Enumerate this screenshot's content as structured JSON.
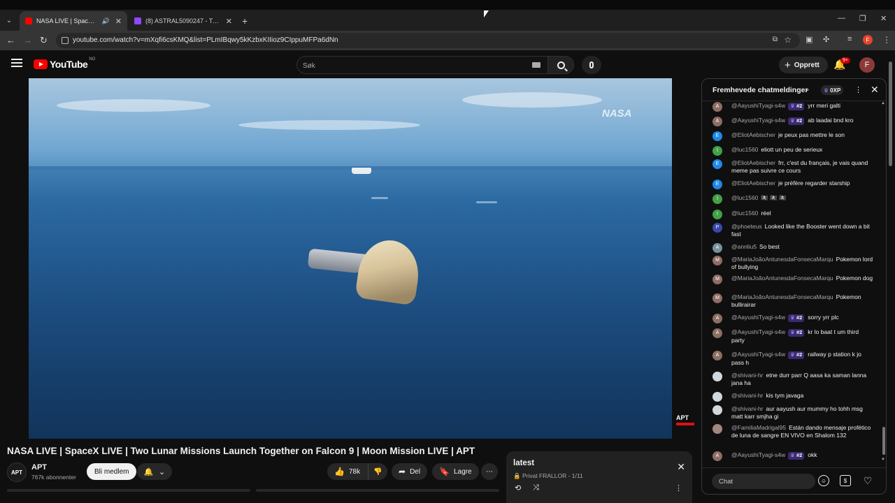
{
  "browser": {
    "tabs": [
      {
        "title": "NASA LIVE | SpaceX LIVE | T",
        "favicon": "youtube-icon",
        "active": true,
        "audio": true
      },
      {
        "title": "(8) ASTRAL5090247 - Twitch",
        "favicon": "twitch-icon",
        "active": false,
        "audio": false
      }
    ],
    "url": "youtube.com/watch?v=mXqfi6csKMQ&list=PLmIBqwy5kKzbxKIIioz9CIppuMFPa6dNn",
    "profile_initial": "F"
  },
  "youtube": {
    "logo_text": "YouTube",
    "region": "NO",
    "search_placeholder": "Søk",
    "create_label": "Opprett",
    "notification_badge": "9+",
    "avatar_initial": "F"
  },
  "video": {
    "watermark_top": "NASA",
    "watermark_bottom": "APT",
    "title": "NASA LIVE | SpaceX LIVE | Two Lunar Missions Launch Together on Falcon 9 | Moon Mission LIVE | APT",
    "channel": {
      "name": "APT",
      "avatar_text": "APT",
      "subscribers": "767k abonnenter",
      "join_label": "Bli medlem"
    },
    "actions": {
      "likes": "78k",
      "share_label": "Del",
      "save_label": "Lagre"
    }
  },
  "playlist": {
    "title": "latest",
    "meta": "Privat FRALLOR - 1/11"
  },
  "chat": {
    "header_title": "Fremhevede chatmeldinger",
    "xp": "0XP",
    "input_placeholder": "Chat",
    "messages": [
      {
        "initial": "A",
        "color": "#8d6e63",
        "author": "@AayushiTyagi-s4w",
        "rank": "#2",
        "text": "yrr meri galti"
      },
      {
        "initial": "A",
        "color": "#8d6e63",
        "author": "@AayushiTyagi-s4w",
        "rank": "#2",
        "text": "ab laadai bnd kro"
      },
      {
        "initial": "E",
        "color": "#1e88e5",
        "author": "@EliotAebischer",
        "rank": "",
        "text": "je peux pas mettre le son"
      },
      {
        "initial": "I",
        "color": "#43a047",
        "author": "@luc1560",
        "rank": "",
        "text": "eliott un peu de serieux"
      },
      {
        "initial": "E",
        "color": "#1e88e5",
        "author": "@EliotAebischer",
        "rank": "",
        "text": "frr, c'est du français, je vais quand meme pas suivre ce cours"
      },
      {
        "initial": "E",
        "color": "#1e88e5",
        "author": "@EliotAebischer",
        "rank": "",
        "text": "je préfère regarder starship"
      },
      {
        "initial": "I",
        "color": "#43a047",
        "author": "@luc1560",
        "rank": "",
        "text": "🏴‍☠️ 🏴‍☠️ 🏴‍☠️"
      },
      {
        "initial": "I",
        "color": "#43a047",
        "author": "@luc1560",
        "rank": "",
        "text": "réel"
      },
      {
        "initial": "P",
        "color": "#3949ab",
        "author": "@phoeteus",
        "rank": "",
        "text": "Looked like the Booster went down a bit fast"
      },
      {
        "initial": "A",
        "color": "#78909c",
        "author": "@annliu5",
        "rank": "",
        "text": "So best"
      },
      {
        "initial": "M",
        "color": "#8d6e63",
        "author": "@MariaJoãoAntunesdaFonsecaMarqu",
        "rank": "",
        "text": "Pokemon lord of bullying"
      },
      {
        "initial": "M",
        "color": "#8d6e63",
        "author": "@MariaJoãoAntunesdaFonsecaMarqu",
        "rank": "",
        "text": "Pokemon dog"
      },
      {
        "initial": "M",
        "color": "#8d6e63",
        "author": "@MariaJoãoAntunesdaFonsecaMarqu",
        "rank": "",
        "text": "Pokemon bullirairar"
      },
      {
        "initial": "A",
        "color": "#8d6e63",
        "author": "@AayushiTyagi-s4w",
        "rank": "#2",
        "text": "sorry yrr plc"
      },
      {
        "initial": "A",
        "color": "#8d6e63",
        "author": "@AayushiTyagi-s4w",
        "rank": "#2",
        "text": "kr lo baat t um third party"
      },
      {
        "initial": "A",
        "color": "#8d6e63",
        "author": "@AayushiTyagi-s4w",
        "rank": "#2",
        "text": "railway p station k jo pass h"
      },
      {
        "initial": "",
        "color": "#cfd8dc",
        "author": "@shivani-hr",
        "rank": "",
        "text": "etne durr parr Q aasa ka saman lanna jana ha"
      },
      {
        "initial": "",
        "color": "#cfd8dc",
        "author": "@shivani-hr",
        "rank": "",
        "text": "kis tym javaga"
      },
      {
        "initial": "",
        "color": "#cfd8dc",
        "author": "@shivani-hr",
        "rank": "",
        "text": "aur aayush aur mummy ho tohh msg matt karr smjha gi"
      },
      {
        "initial": "",
        "color": "#a1887f",
        "author": "@FamiliaMadrigal95",
        "rank": "",
        "text": "Están dando mensaje profético de luna de sangre EN VIVO en Shalom 132"
      },
      {
        "initial": "A",
        "color": "#8d6e63",
        "author": "@AayushiTyagi-s4w",
        "rank": "#2",
        "text": "okk"
      }
    ]
  }
}
